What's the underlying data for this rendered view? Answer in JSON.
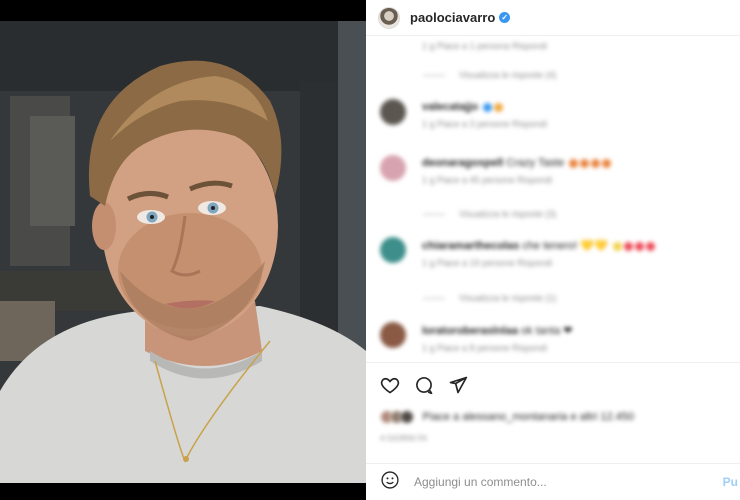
{
  "post": {
    "username": "paolociavarro",
    "verified_mark": "✓"
  },
  "comments": [
    {
      "kind": "reply-meta",
      "meta": "1 g   Piace a 1 persona   Rispondi"
    },
    {
      "kind": "view-replies",
      "text": "Visualizza le risposte (4)"
    },
    {
      "kind": "comment",
      "user": "valecatajjo",
      "text": "🌟",
      "meta": "1 g   Piace a 3 persone   Rispondi",
      "avatar_color": "#5b5650"
    },
    {
      "kind": "comment",
      "user": "deonaragospell",
      "text": "Crazy Taste",
      "meta": "1 g   Piace a 45 persone   Rispondi",
      "avatar_color": "#d8a3b0"
    },
    {
      "kind": "view-replies",
      "text": "Visualizza le risposte (3)"
    },
    {
      "kind": "comment",
      "user": "chiaramarthecolas",
      "text": "che tenero! 💛💛",
      "meta": "1 g   Piace a 19 persone   Rispondi",
      "avatar_color": "#3d8f8b"
    },
    {
      "kind": "view-replies",
      "text": "Visualizza le risposte (1)"
    },
    {
      "kind": "comment",
      "user": "loratoroberaslnlaa",
      "text": "ok tanta ❤",
      "meta": "1 g   Piace a 8 persone   Rispondi",
      "avatar_color": "#8a5a45"
    }
  ],
  "actions": {
    "like_icon": "heart-icon",
    "comment_icon": "comment-bubble-icon",
    "share_icon": "paper-plane-icon"
  },
  "likes": {
    "text": "Piace a alessano_montanaria e altri 12.450"
  },
  "post_date": "4 GIORNI FA",
  "add_comment": {
    "placeholder": "Aggiungi un commento...",
    "emoji_icon": "smiley-icon",
    "publish_label": "Pu"
  },
  "colors": {
    "accent": "#3897f0",
    "publish_disabled": "#9fcff7",
    "heart_emoji": "#ed4956"
  }
}
